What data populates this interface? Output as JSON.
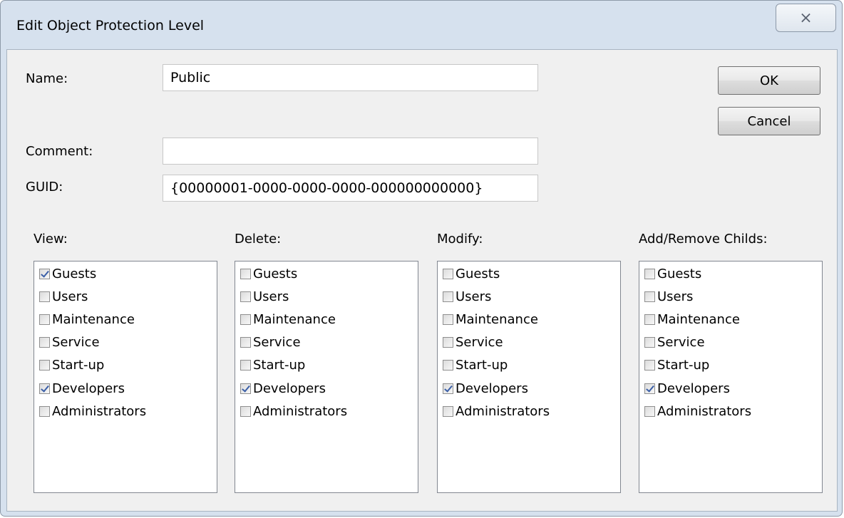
{
  "window": {
    "title": "Edit Object Protection Level",
    "close_glyph": "⨯"
  },
  "fields": {
    "name_label": "Name:",
    "name_value": "Public",
    "comment_label": "Comment:",
    "comment_value": "",
    "guid_label": "GUID:",
    "guid_value": "{00000001-0000-0000-0000-000000000000}"
  },
  "buttons": {
    "ok": "OK",
    "cancel": "Cancel"
  },
  "groups": [
    {
      "label": "View:",
      "items": [
        {
          "label": "Guests",
          "checked": true
        },
        {
          "label": "Users",
          "checked": false
        },
        {
          "label": "Maintenance",
          "checked": false
        },
        {
          "label": "Service",
          "checked": false
        },
        {
          "label": "Start-up",
          "checked": false
        },
        {
          "label": "Developers",
          "checked": true
        },
        {
          "label": "Administrators",
          "checked": false
        }
      ]
    },
    {
      "label": "Delete:",
      "items": [
        {
          "label": "Guests",
          "checked": false
        },
        {
          "label": "Users",
          "checked": false
        },
        {
          "label": "Maintenance",
          "checked": false
        },
        {
          "label": "Service",
          "checked": false
        },
        {
          "label": "Start-up",
          "checked": false
        },
        {
          "label": "Developers",
          "checked": true
        },
        {
          "label": "Administrators",
          "checked": false
        }
      ]
    },
    {
      "label": "Modify:",
      "items": [
        {
          "label": "Guests",
          "checked": false
        },
        {
          "label": "Users",
          "checked": false
        },
        {
          "label": "Maintenance",
          "checked": false
        },
        {
          "label": "Service",
          "checked": false
        },
        {
          "label": "Start-up",
          "checked": false
        },
        {
          "label": "Developers",
          "checked": true
        },
        {
          "label": "Administrators",
          "checked": false
        }
      ]
    },
    {
      "label": "Add/Remove Childs:",
      "items": [
        {
          "label": "Guests",
          "checked": false
        },
        {
          "label": "Users",
          "checked": false
        },
        {
          "label": "Maintenance",
          "checked": false
        },
        {
          "label": "Service",
          "checked": false
        },
        {
          "label": "Start-up",
          "checked": false
        },
        {
          "label": "Developers",
          "checked": true
        },
        {
          "label": "Administrators",
          "checked": false
        }
      ]
    }
  ]
}
